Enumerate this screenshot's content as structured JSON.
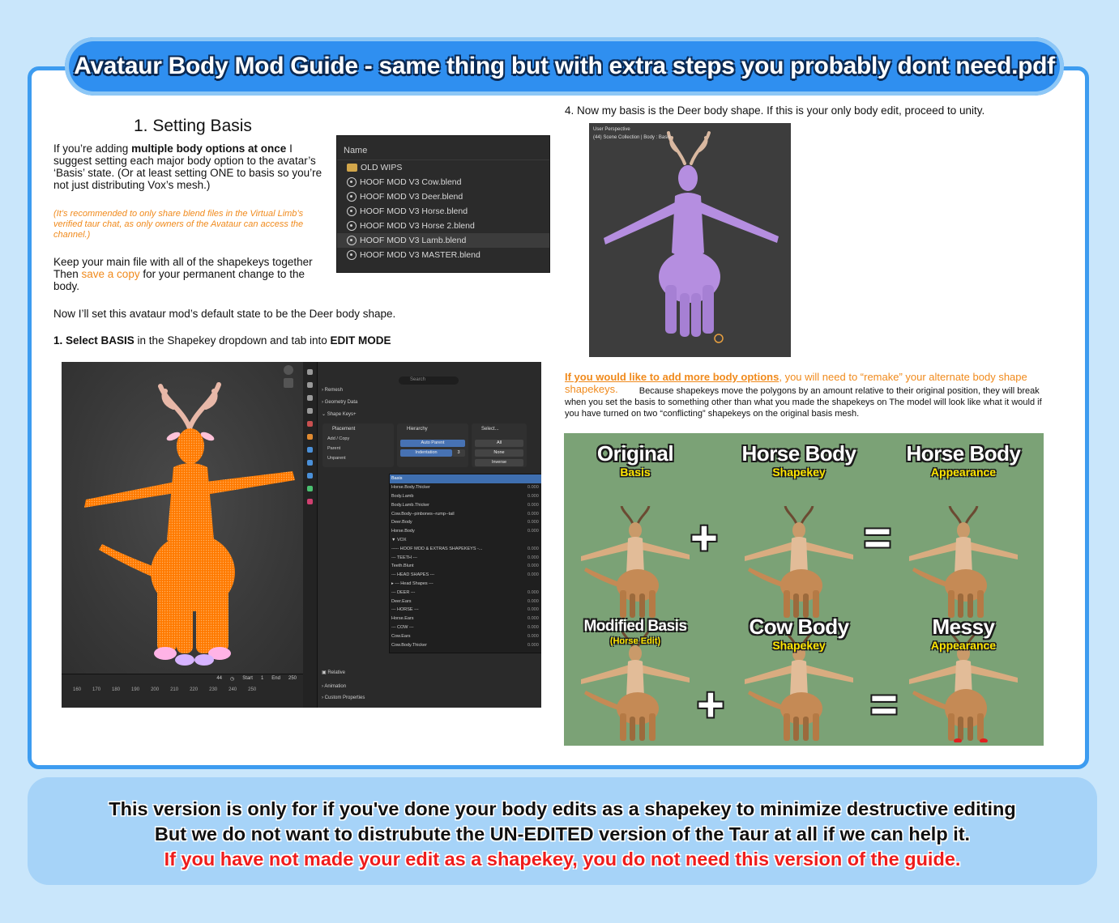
{
  "title": "Avataur Body Mod Guide - same thing but with extra steps you probably dont need.pdf",
  "left": {
    "heading": "1. Setting Basis",
    "intro_a": "If you’re adding ",
    "intro_bold": "multiple body options at once",
    "intro_b": " I suggest setting each major body option to the avatar’s ‘Basis’ state. (Or at least setting ONE to basis so you’re not just distributing Vox’s mesh.)",
    "note": "(It’s recommended to only share blend files in the Virtual Limb’s verified taur chat, as only owners of the Avataur can access the channel.)",
    "keep_a": "Keep your main file with all of the shapekeys together Then ",
    "keep_link": "save a copy",
    "keep_b": " for your permanent change to the body.",
    "default_state": "Now I’ll set this avataur mod’s default state to be the Deer body shape.",
    "step_bold1": "1. Select BASIS",
    "step_mid": " in the Shapekey dropdown and tab into ",
    "step_bold2": "EDIT MODE"
  },
  "file_browser": {
    "header": "Name",
    "items": [
      {
        "name": "OLD WIPS",
        "icon": "folder-icon"
      },
      {
        "name": "HOOF MOD V3 Cow.blend",
        "icon": "blend-file-icon"
      },
      {
        "name": "HOOF MOD V3 Deer.blend",
        "icon": "blend-file-icon"
      },
      {
        "name": "HOOF MOD V3 Horse.blend",
        "icon": "blend-file-icon"
      },
      {
        "name": "HOOF MOD V3 Horse 2.blend",
        "icon": "blend-file-icon"
      },
      {
        "name": "HOOF MOD V3 Lamb.blend",
        "icon": "blend-file-icon"
      },
      {
        "name": "HOOF MOD V3 MASTER.blend",
        "icon": "blend-file-icon"
      }
    ]
  },
  "blender": {
    "search": "Search",
    "sections": [
      "Remesh",
      "Geometry Data",
      "Shape Keys+"
    ],
    "placement": {
      "title": "Placement",
      "items": [
        "Add / Copy",
        "Parent",
        "Unparent"
      ]
    },
    "hierarchy": {
      "title": "Hierarchy",
      "auto_parent": "Auto Parent",
      "indentation": "Indentation",
      "indent_value": "3"
    },
    "select": {
      "title": "Select...",
      "items": [
        "All",
        "None",
        "Inverse"
      ]
    },
    "shapekeys": [
      {
        "name": "Basis",
        "value": ""
      },
      {
        "name": "Horse.Body.Thicker",
        "value": "0.000"
      },
      {
        "name": "Body.Lamb",
        "value": "0.000"
      },
      {
        "name": "Body.Lamb.Thicker",
        "value": "0.000"
      },
      {
        "name": "Cow.Body--pinbones--rump--tail",
        "value": "0.000"
      },
      {
        "name": "Deer.Body",
        "value": "0.000"
      },
      {
        "name": "Horse.Body",
        "value": "0.000"
      },
      {
        "name": "▼ VOX",
        "value": ""
      },
      {
        "name": "----- HOOF MOD & EXTRAS SHAPEKEYS -...",
        "value": "0.000"
      },
      {
        "name": "--- TEETH ---",
        "value": "0.000"
      },
      {
        "name": "Teeth.Blunt",
        "value": "0.000"
      },
      {
        "name": "--- HEAD SHAPES ---",
        "value": "0.000"
      },
      {
        "name": "  ▸ --- Head Shapes ---",
        "value": ""
      },
      {
        "name": "--- DEER ---",
        "value": "0.000"
      },
      {
        "name": "Deer.Ears",
        "value": "0.000"
      },
      {
        "name": "--- HORSE ---",
        "value": "0.000"
      },
      {
        "name": "Horse.Ears",
        "value": "0.000"
      },
      {
        "name": "--- COW ---",
        "value": "0.000"
      },
      {
        "name": "Cow.Ears",
        "value": "0.000"
      },
      {
        "name": "Cow.Body.Thicker",
        "value": "0.000"
      }
    ],
    "relative": "Relative",
    "animation": "Animation",
    "custom_properties": "Custom Properties",
    "timeline": {
      "frame": "44",
      "start_label": "Start",
      "start": "1",
      "end_label": "End",
      "end": "250",
      "ticks": [
        "160",
        "170",
        "180",
        "190",
        "200",
        "210",
        "220",
        "230",
        "240",
        "250"
      ]
    }
  },
  "right": {
    "step4": "4. Now my basis is the Deer body shape. If this is your only body edit, proceed to unity.",
    "viewport_line1": "User Perspective",
    "viewport_line2": "(44) Scene Collection | Body : Basis",
    "more_link": "If you would like to add more body options",
    "more_a": ", you will need to “remake” your alternate body shape shapekeys.",
    "more_b": " Because shapekeys move the polygons by an amount relative to their original position, they will break when you set the basis to something other than what you made the shapekeys on The model will look like what it would if you have turned on two “conflicting” shapekeys on the original basis mesh."
  },
  "comparison": {
    "row1": [
      {
        "title": "Original",
        "sub": "Basis"
      },
      {
        "title": "Horse Body",
        "sub": "Shapekey"
      },
      {
        "title": "Horse Body",
        "sub": "Appearance"
      }
    ],
    "row2": [
      {
        "title": "Modified Basis",
        "sub": "(Horse Edit)"
      },
      {
        "title": "Cow Body",
        "sub": "Shapekey"
      },
      {
        "title": "Messy",
        "sub": "Appearance"
      }
    ]
  },
  "footer": {
    "line1": "This version is only for if you've done your body edits as a shapekey to minimize destructive editing",
    "line2": "But we do not want to distrubute the UN-EDITED version of the Taur at all if we can help it.",
    "line3": "If you have not made your edit as a shapekey, you do not need this version of the guide."
  },
  "colors": {
    "accent": "#2f8ff0",
    "orange": "#f08a1c",
    "warning": "#ee1c1c",
    "mesh_orange": "#ff7f00",
    "mesh_lilac": "#b58ee0"
  }
}
